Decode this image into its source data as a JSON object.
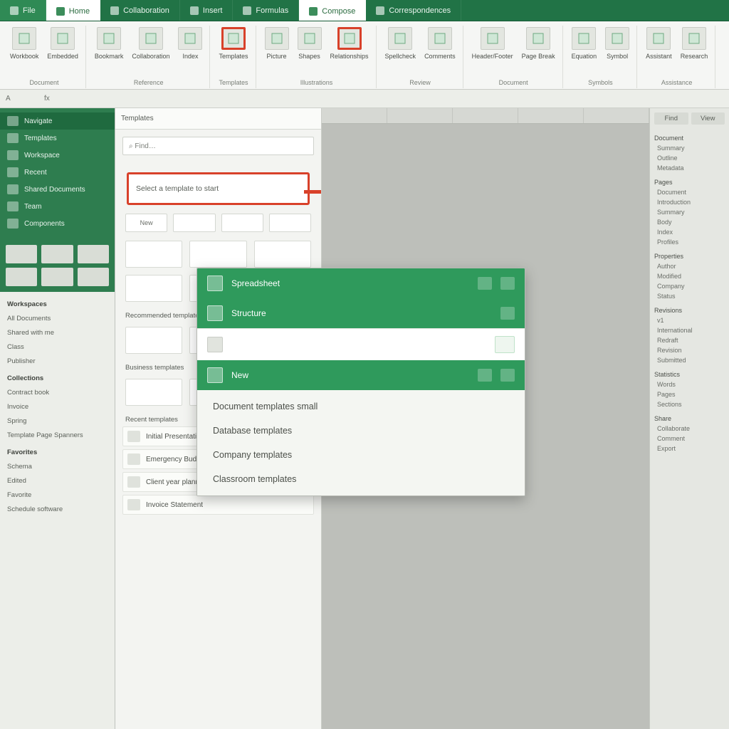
{
  "tabs": [
    {
      "label": "File",
      "kind": "alt"
    },
    {
      "label": "Home",
      "kind": "sel"
    },
    {
      "label": "Collaboration",
      "kind": "plain"
    },
    {
      "label": "Insert",
      "kind": "plain"
    },
    {
      "label": "Formulas",
      "kind": "plain"
    },
    {
      "label": "Compose",
      "kind": "sel-accent"
    },
    {
      "label": "Correspondences",
      "kind": "plain"
    }
  ],
  "ribbon": {
    "groups": [
      {
        "name": "clipboard",
        "label": "Document",
        "buttons": [
          {
            "name": "new-doc-button",
            "label": "Workbook"
          },
          {
            "name": "open-doc-button",
            "label": "Embedded"
          }
        ]
      },
      {
        "name": "reference",
        "label": "Reference",
        "buttons": [
          {
            "name": "bookmark-button",
            "label": "Bookmark"
          },
          {
            "name": "cross-ref-button",
            "label": "Collaboration"
          },
          {
            "name": "index-button",
            "label": "Index"
          }
        ]
      },
      {
        "name": "templates",
        "label": "Templates",
        "buttons": [
          {
            "name": "template-gallery-button",
            "label": "Templates",
            "highlight": true
          }
        ]
      },
      {
        "name": "illustrate",
        "label": "Illustrations",
        "buttons": [
          {
            "name": "picture-button",
            "label": "Picture"
          },
          {
            "name": "shapes-button",
            "label": "Shapes"
          },
          {
            "name": "smartart-button",
            "label": "Relationships",
            "highlight": true
          }
        ]
      },
      {
        "name": "review",
        "label": "Review",
        "buttons": [
          {
            "name": "spelling-button",
            "label": "Spellcheck"
          },
          {
            "name": "comments-button",
            "label": "Comments"
          }
        ]
      },
      {
        "name": "page",
        "label": "Document",
        "buttons": [
          {
            "name": "header-button",
            "label": "Header/Footer"
          },
          {
            "name": "page-num-button",
            "label": "Page Break"
          }
        ]
      },
      {
        "name": "symbols",
        "label": "Symbols",
        "buttons": [
          {
            "name": "equation-button",
            "label": "Equation"
          },
          {
            "name": "symbol-button",
            "label": "Symbol"
          }
        ]
      },
      {
        "name": "assist",
        "label": "Assistance",
        "buttons": [
          {
            "name": "help-button",
            "label": "Assistant"
          },
          {
            "name": "research-button",
            "label": "Research"
          }
        ]
      }
    ]
  },
  "toolbar2": {
    "cells": [
      "A",
      "fx",
      "",
      "",
      "",
      "",
      "",
      "",
      "",
      "",
      "",
      "",
      ""
    ]
  },
  "nav": {
    "title": "Navigate",
    "top_items": [
      {
        "label": "Templates"
      },
      {
        "label": "Workspace"
      },
      {
        "label": "Recent"
      },
      {
        "label": "Shared Documents"
      },
      {
        "label": "Team"
      },
      {
        "label": "Components"
      }
    ],
    "bottom": {
      "heads": [
        "Workspaces",
        "Collections",
        "Favorites"
      ],
      "items": [
        "All Documents",
        "Shared with me",
        "Class",
        "Publisher",
        "Contract book",
        "Invoice",
        "Spring",
        "Template Page Spanners",
        "Schema",
        "Edited",
        "Favorite",
        "Schedule software"
      ]
    }
  },
  "gallery": {
    "header": "Templates",
    "search_placeholder": "Find…",
    "callout_text": "Select a template to start",
    "chip_row": [
      "New",
      "",
      "",
      ""
    ],
    "sections": [
      {
        "label": "Recommended templates"
      },
      {
        "label": "Business templates"
      },
      {
        "label": "Recent templates"
      }
    ],
    "list": [
      {
        "label": "Initial Presentation"
      },
      {
        "label": "Emergency Budget"
      },
      {
        "label": "Client year planner"
      },
      {
        "label": "Invoice Statement"
      }
    ]
  },
  "dropdown": {
    "title": "Spreadsheet",
    "subtitle": "Structure",
    "row_blank": "",
    "group_label": "New",
    "items": [
      "Document templates small",
      "Database templates",
      "Company templates",
      "Classroom templates"
    ]
  },
  "rnav": {
    "tabs": [
      "Find",
      "View"
    ],
    "sections": [
      {
        "title": "Document",
        "items": [
          "Summary",
          "Outline",
          "Metadata"
        ]
      },
      {
        "title": "Pages",
        "items": [
          "Document",
          "Introduction",
          "Summary",
          "Body",
          "Index",
          "Profiles"
        ]
      },
      {
        "title": "Properties",
        "items": [
          "Author",
          "Modified",
          "Company",
          "Status"
        ]
      },
      {
        "title": "Revisions",
        "items": [
          "v1",
          "International",
          "Redraft",
          "Revision",
          "Submitted"
        ]
      },
      {
        "title": "Statistics",
        "items": [
          "Words",
          "Pages",
          "Sections"
        ]
      },
      {
        "title": "Share",
        "items": [
          "Collaborate",
          "Comment",
          "Export"
        ]
      }
    ]
  },
  "colors": {
    "brand_green": "#217346",
    "accent_green": "#2f9a5c",
    "highlight_red": "#d8412a",
    "panel_bg": "#f3f4f1",
    "canvas_dim": "#bdbfba"
  }
}
